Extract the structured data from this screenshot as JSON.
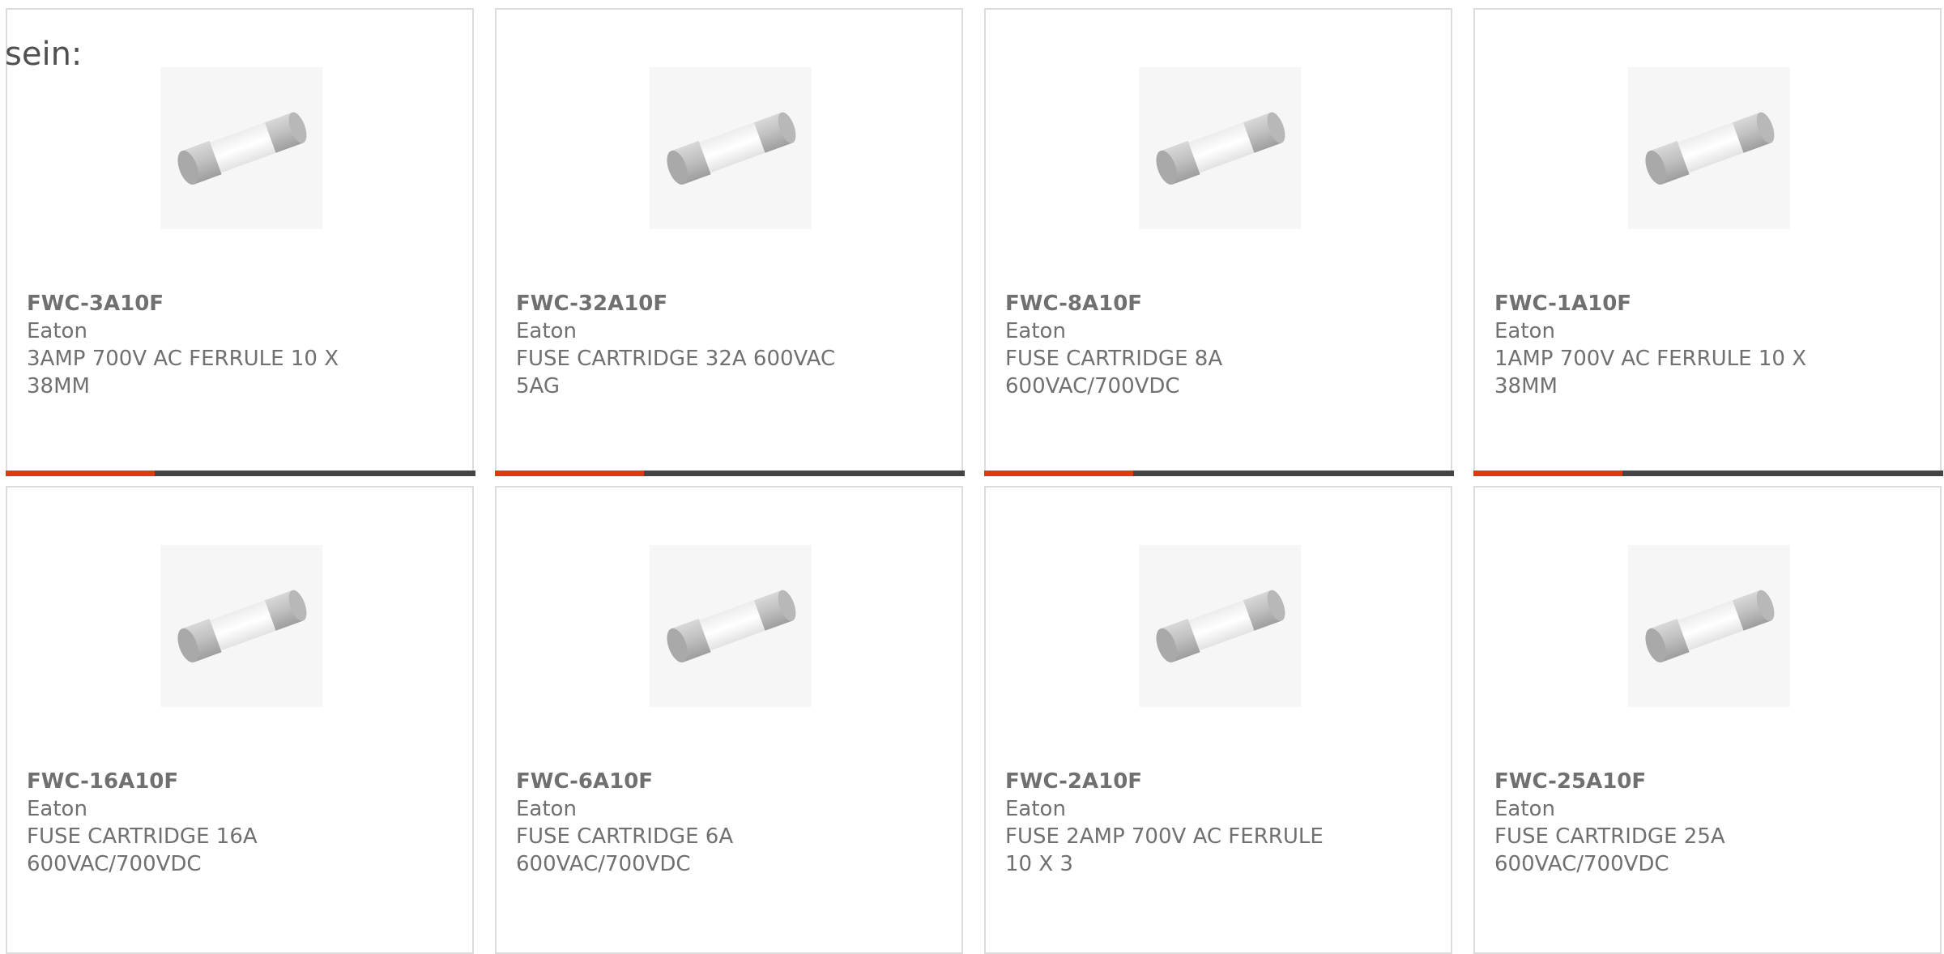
{
  "heading": "sein:",
  "colors": {
    "accent": "#e0380f",
    "bar": "#444444",
    "border": "#dcdcdc",
    "text": "#707070"
  },
  "products": [
    {
      "part": "FWC-3A10F",
      "manufacturer": "Eaton",
      "description": "3AMP 700V AC FERRULE 10 X 38MM",
      "image_icon": "fuse-icon"
    },
    {
      "part": "FWC-32A10F",
      "manufacturer": "Eaton",
      "description": "FUSE CARTRIDGE 32A 600VAC 5AG",
      "image_icon": "fuse-icon"
    },
    {
      "part": "FWC-8A10F",
      "manufacturer": "Eaton",
      "description": "FUSE CARTRIDGE 8A 600VAC/700VDC",
      "image_icon": "fuse-icon"
    },
    {
      "part": "FWC-1A10F",
      "manufacturer": "Eaton",
      "description": "1AMP 700V AC FERRULE 10 X 38MM",
      "image_icon": "fuse-icon"
    },
    {
      "part": "FWC-16A10F",
      "manufacturer": "Eaton",
      "description": "FUSE CARTRIDGE 16A 600VAC/700VDC",
      "image_icon": "fuse-icon"
    },
    {
      "part": "FWC-6A10F",
      "manufacturer": "Eaton",
      "description": "FUSE CARTRIDGE 6A 600VAC/700VDC",
      "image_icon": "fuse-icon"
    },
    {
      "part": "FWC-2A10F",
      "manufacturer": "Eaton",
      "description": "FUSE 2AMP 700V AC FERRULE 10 X 3",
      "image_icon": "fuse-icon"
    },
    {
      "part": "FWC-25A10F",
      "manufacturer": "Eaton",
      "description": "FUSE CARTRIDGE 25A 600VAC/700VDC",
      "image_icon": "fuse-icon"
    }
  ]
}
